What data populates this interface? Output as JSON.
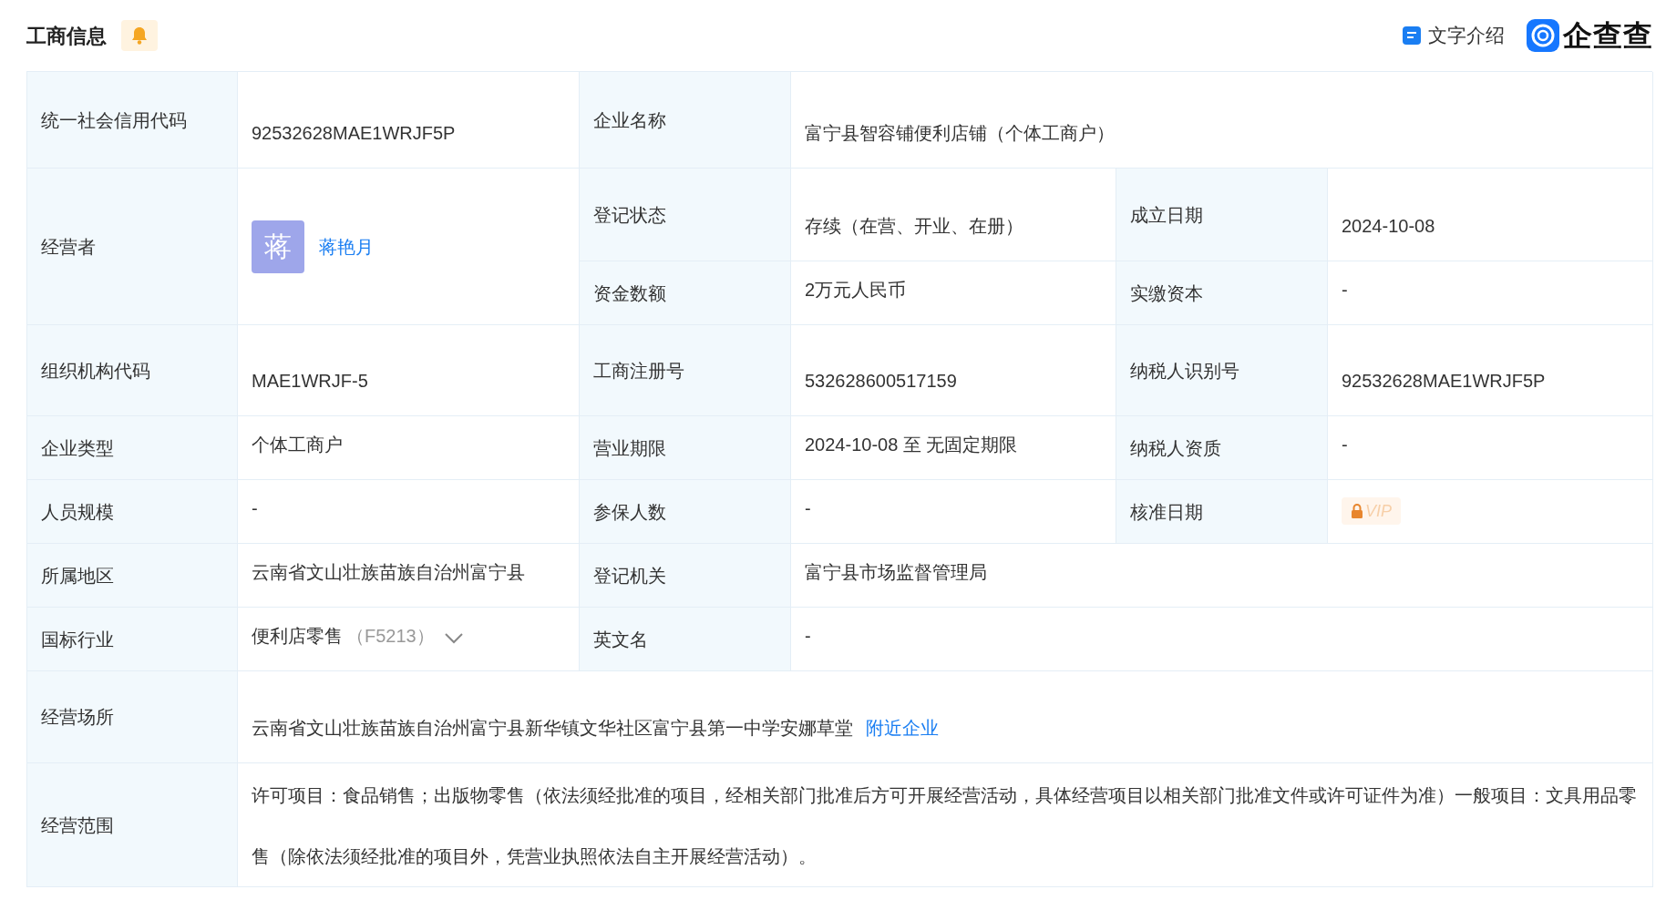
{
  "header": {
    "title": "工商信息",
    "intro_link": "文字介绍",
    "logo": "企查查"
  },
  "fields": [
    {
      "label": "统一社会信用代码",
      "kind": "text",
      "value": "92532628MAE1WRJF5P"
    },
    {
      "label": "企业名称",
      "kind": "text",
      "value": "富宁县智容铺便利店铺（个体工商户）"
    },
    {
      "label": "经营者",
      "kind": "person",
      "avatar": "蒋",
      "value": "蒋艳月"
    },
    {
      "label": "登记状态",
      "kind": "text",
      "value": "存续（在营、开业、在册）"
    },
    {
      "label": "成立日期",
      "kind": "text",
      "value": "2024-10-08"
    },
    {
      "label": "资金数额",
      "kind": "text",
      "value": "2万元人民币"
    },
    {
      "label": "实缴资本",
      "kind": "text",
      "value": "-"
    },
    {
      "label": "组织机构代码",
      "kind": "text",
      "value": "MAE1WRJF-5"
    },
    {
      "label": "工商注册号",
      "kind": "text",
      "value": "532628600517159"
    },
    {
      "label": "纳税人识别号",
      "kind": "text",
      "value": "92532628MAE1WRJF5P"
    },
    {
      "label": "企业类型",
      "kind": "text",
      "value": "个体工商户"
    },
    {
      "label": "营业期限",
      "kind": "text",
      "value": "2024-10-08 至 无固定期限"
    },
    {
      "label": "纳税人资质",
      "kind": "text",
      "value": "-"
    },
    {
      "label": "人员规模",
      "kind": "text",
      "value": "-"
    },
    {
      "label": "参保人数",
      "kind": "text",
      "value": "-"
    },
    {
      "label": "核准日期",
      "kind": "locked",
      "value": "VIP"
    },
    {
      "label": "所属地区",
      "kind": "text",
      "value": "云南省文山壮族苗族自治州富宁县"
    },
    {
      "label": "登记机关",
      "kind": "text",
      "value": "富宁县市场监督管理局"
    },
    {
      "label": "国标行业",
      "kind": "industry",
      "value": "便利店零售",
      "code": "（F5213）"
    },
    {
      "label": "英文名",
      "kind": "text",
      "value": "-"
    },
    {
      "label": "经营场所",
      "kind": "address",
      "value": "云南省文山壮族苗族自治州富宁县新华镇文华社区富宁县第一中学安娜草堂",
      "link": "附近企业"
    },
    {
      "label": "经营范围",
      "kind": "scope",
      "value": "许可项目：食品销售；出版物零售（依法须经批准的项目，经相关部门批准后方可开展经营活动，具体经营项目以相关部门批准文件或许可证件为准）一般项目：文具用品零售（除依法须经批准的项目外，凭营业执照依法自主开展经营活动）。"
    }
  ]
}
